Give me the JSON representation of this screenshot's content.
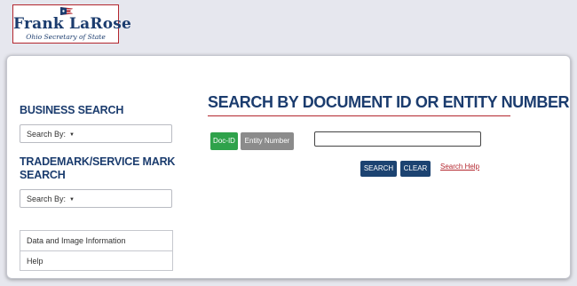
{
  "header": {
    "logo_name": "Frank LaRose",
    "logo_title": "Ohio Secretary of State"
  },
  "sidebar": {
    "business_search_heading": "BUSINESS SEARCH",
    "business_search_dropdown": "Search By:",
    "trademark_heading_line1": "TRADEMARK/SERVICE MARK",
    "trademark_heading_line2": "SEARCH",
    "trademark_dropdown": "Search By:",
    "links": [
      "Data and Image Information",
      "Help"
    ]
  },
  "main": {
    "title": "SEARCH BY DOCUMENT ID OR ENTITY NUMBER",
    "toggle_doc_id": "Doc-ID",
    "toggle_entity_number": "Entity Number",
    "document_input_value": "",
    "search_button": "SEARCH",
    "clear_button": "CLEAR",
    "search_help_link": "Search Help"
  },
  "colors": {
    "navy": "#1b3c6e",
    "red": "#b3262e",
    "green": "#2fa24b",
    "gray": "#8b8b8b",
    "page_bg": "#e6e7ee"
  },
  "icons": {
    "logo_flag": "ohio-flag-icon",
    "dropdown_caret": "caret-down-icon"
  }
}
